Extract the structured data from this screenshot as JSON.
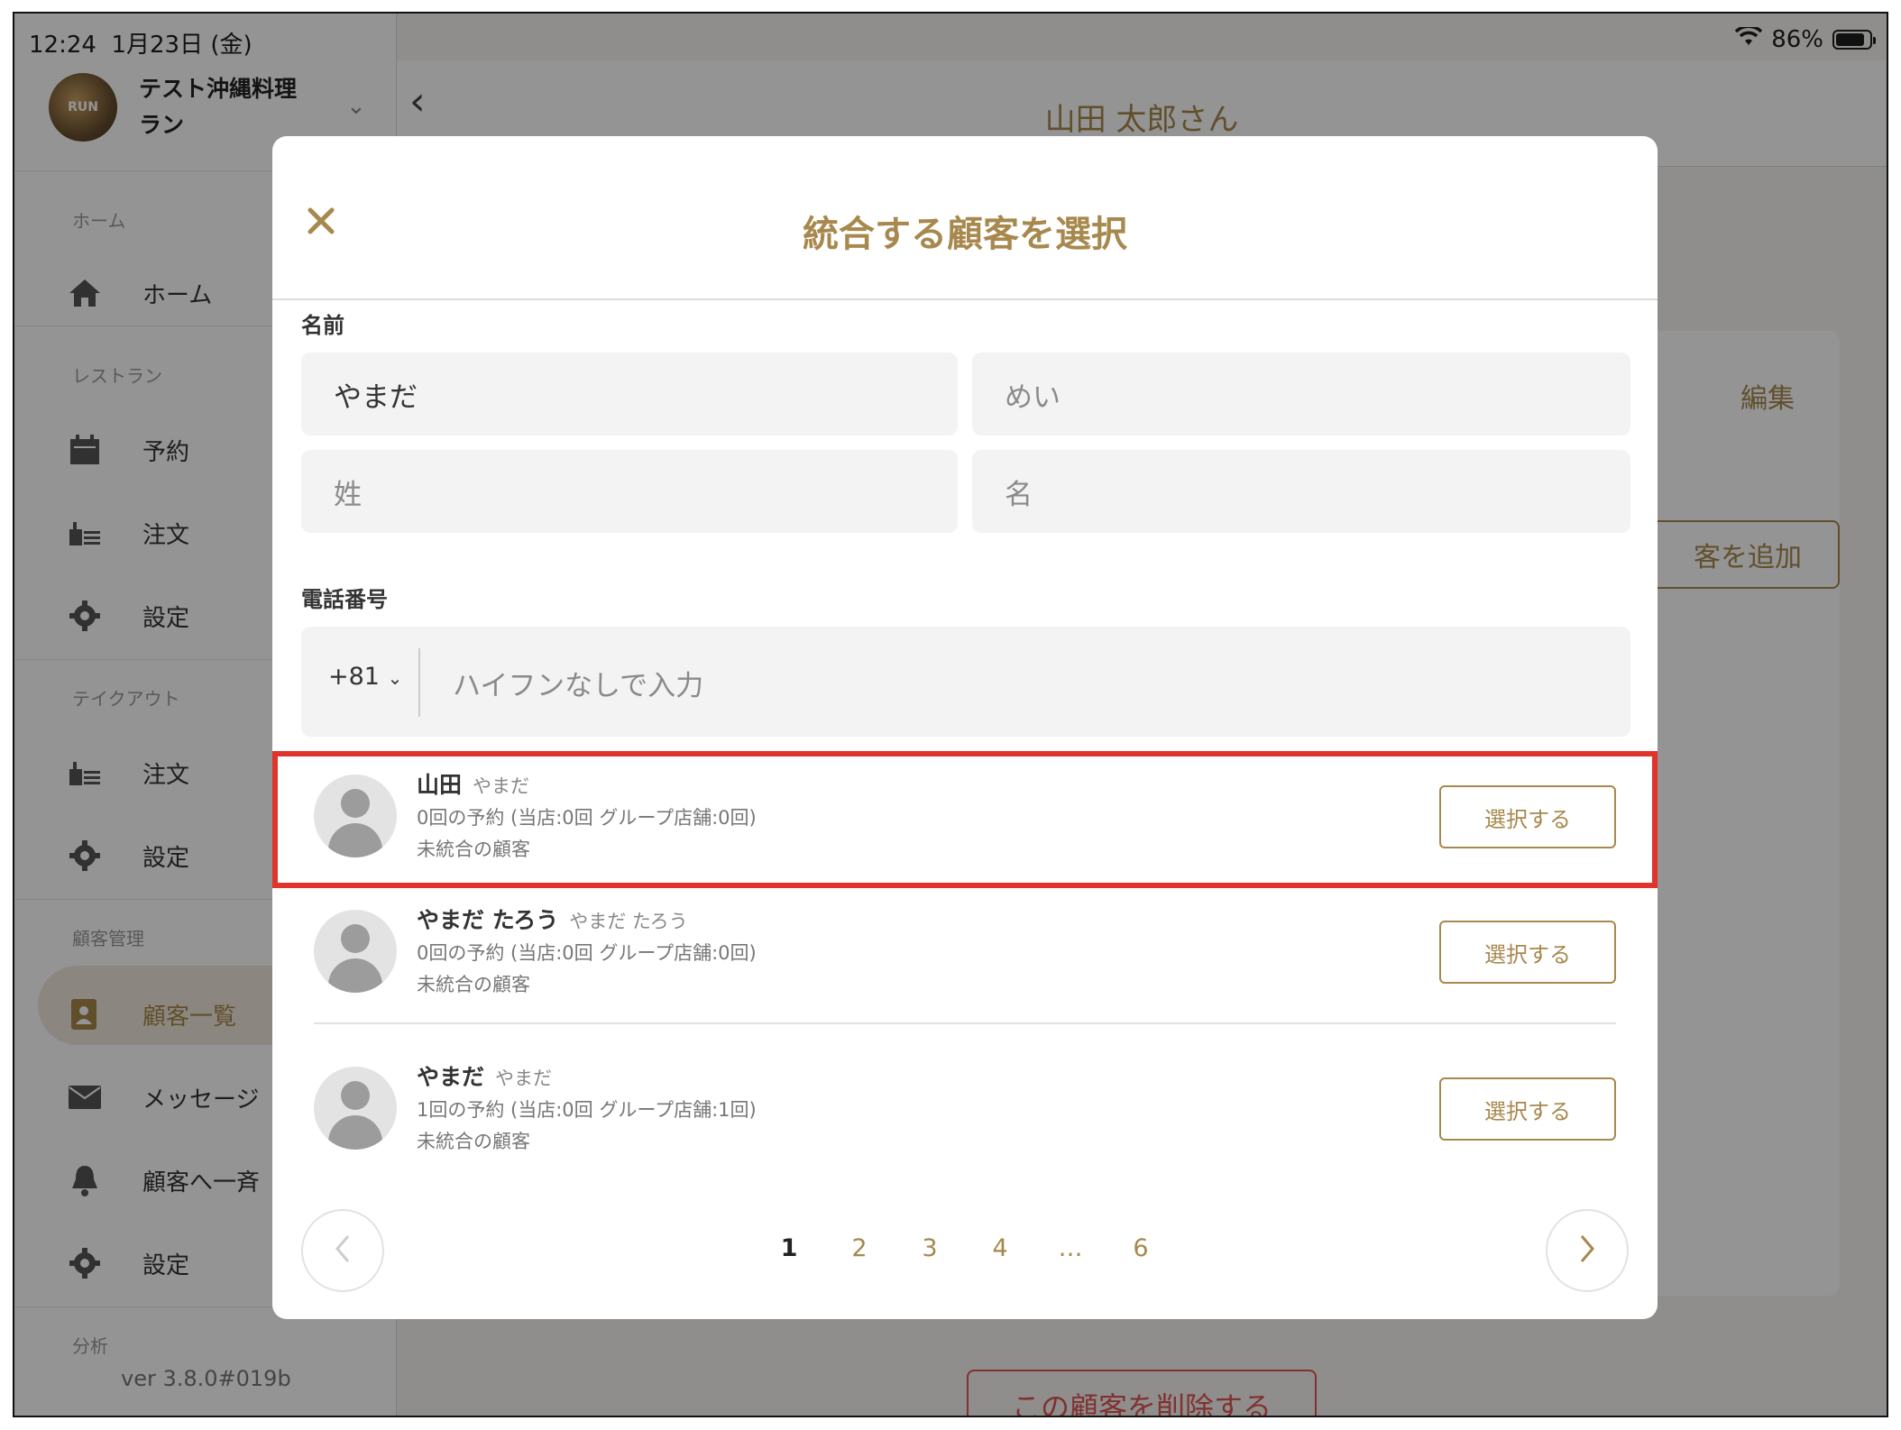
{
  "status_bar": {
    "time": "12:24",
    "date": "1月23日 (金)",
    "battery": "86%",
    "battery_level": 0.86
  },
  "sidebar": {
    "store_logo_text": "RUN",
    "store_name_line1": "テスト沖縄料理",
    "store_name_line2": "ラン",
    "section_home": "ホーム",
    "home": "ホーム",
    "section_restaurant": "レストラン",
    "reservation": "予約",
    "order": "注文",
    "settings": "設定",
    "section_takeout": "テイクアウト",
    "takeout_order": "注文",
    "takeout_settings": "設定",
    "section_customer": "顧客管理",
    "customer_list": "顧客一覧",
    "message": "メッセージ",
    "broadcast": "顧客へ一斉",
    "customer_settings": "設定",
    "section_analytics": "分析",
    "version": "ver 3.8.0#019b"
  },
  "background": {
    "title": "山田 太郎さん",
    "edit": "編集",
    "add_customer": "客を追加",
    "delete_customer": "この顧客を削除する"
  },
  "modal": {
    "title": "統合する顧客を選択",
    "name_label": "名前",
    "name_fields": {
      "kana_last": "やまだ",
      "kana_first_placeholder": "めい",
      "last_placeholder": "姓",
      "first_placeholder": "名"
    },
    "phone_label": "電話番号",
    "country_code": "+81",
    "phone_placeholder": "ハイフンなしで入力",
    "results": [
      {
        "name": "山田",
        "kana": "やまだ",
        "reservations": "0回の予約 (当店:0回 グループ店舗:0回)",
        "status": "未統合の顧客",
        "button": "選択する"
      },
      {
        "name": "やまだ たろう",
        "kana": "やまだ たろう",
        "reservations": "0回の予約 (当店:0回 グループ店舗:0回)",
        "status": "未統合の顧客",
        "button": "選択する"
      },
      {
        "name": "やまだ",
        "kana": "やまだ",
        "reservations": "1回の予約 (当店:0回 グループ店舗:1回)",
        "status": "未統合の顧客",
        "button": "選択する"
      }
    ],
    "pagination": {
      "pages": [
        "1",
        "2",
        "3",
        "4",
        "…",
        "6"
      ],
      "current": "1"
    }
  },
  "colors": {
    "accent": "#a7884d",
    "highlight": "#e0332c"
  }
}
